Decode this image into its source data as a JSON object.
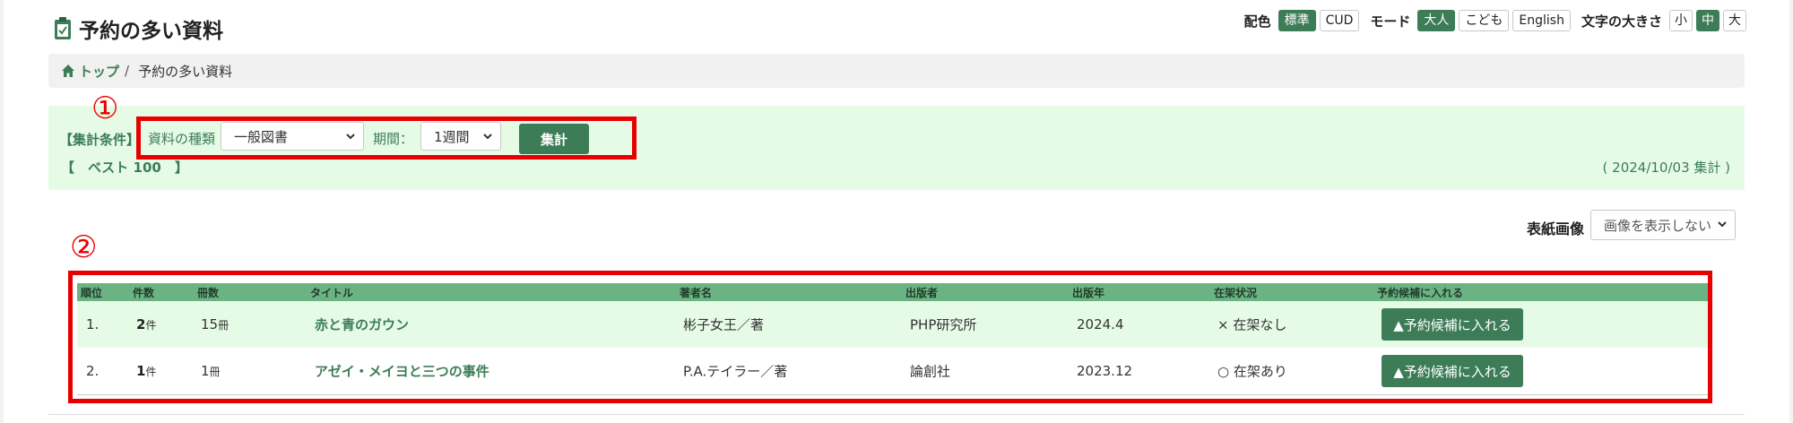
{
  "page": {
    "title": "予約の多い資料"
  },
  "top_controls": {
    "color_label": "配色",
    "color_options": [
      {
        "label": "標準",
        "active": true
      },
      {
        "label": "CUD",
        "active": false
      }
    ],
    "mode_label": "モード",
    "mode_options": [
      {
        "label": "大人",
        "active": true
      },
      {
        "label": "こども",
        "active": false
      },
      {
        "label": "English",
        "active": false
      }
    ],
    "font_size_label": "文字の大きさ",
    "font_size_options": [
      {
        "label": "小",
        "active": false
      },
      {
        "label": "中",
        "active": true
      },
      {
        "label": "大",
        "active": false
      }
    ]
  },
  "breadcrumb": {
    "home_label": "トップ",
    "separator": "/",
    "current": "予約の多い資料"
  },
  "conditions": {
    "label": "【集計条件】",
    "type_label": "資料の種類",
    "type_value": "一般図書",
    "period_label": "期間：",
    "period_value": "1週間",
    "submit_label": "集計",
    "best_label": "【　ベスト 100　】",
    "aggregate_date": "( 2024/10/03 集計 )"
  },
  "annotations": {
    "marker_1": "①",
    "marker_2": "②",
    "color": "#e80000"
  },
  "cover": {
    "label": "表紙画像",
    "value": "画像を表示しない"
  },
  "table": {
    "headers": {
      "rank": "順位",
      "count": "件数",
      "volumes": "冊数",
      "title": "タイトル",
      "author": "著者名",
      "publisher": "出版者",
      "year": "出版年",
      "status": "在架状況",
      "action": "予約候補に入れる"
    },
    "rows": [
      {
        "rank": "1.",
        "count": "2",
        "count_unit": "件",
        "volumes": "15",
        "volumes_unit": "冊",
        "title": "赤と青のガウン",
        "author": "彬子女王／著",
        "publisher": "PHP研究所",
        "year": "2024.4",
        "status": "× 在架なし",
        "action_label": "▲予約候補に入れる"
      },
      {
        "rank": "2.",
        "count": "1",
        "count_unit": "件",
        "volumes": "1",
        "volumes_unit": "冊",
        "title": "アゼイ・メイヨと三つの事件",
        "author": "P.A.テイラー／著",
        "publisher": "論創社",
        "year": "2023.12",
        "status": "○ 在架あり",
        "action_label": "▲予約候補に入れる"
      }
    ]
  },
  "colors": {
    "accent": "#3c7d58",
    "header_row": "#6cb384",
    "panel": "#e6fbe6",
    "annotation": "#e80000"
  }
}
